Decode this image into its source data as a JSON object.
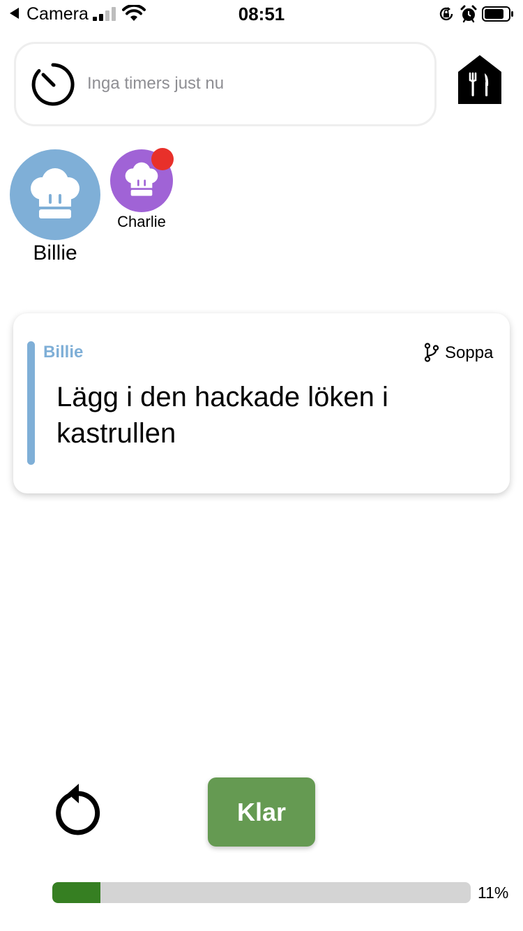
{
  "status_bar": {
    "back_app": "Camera",
    "time": "08:51",
    "icons": [
      "back-arrow-icon",
      "signal-icon",
      "wifi-icon",
      "orientation-lock-icon",
      "alarm-icon",
      "battery-icon"
    ]
  },
  "timer": {
    "text": "Inga timers just nu",
    "icon": "timer-icon"
  },
  "kitchen": {
    "icon": "kitchen-house-icon"
  },
  "cooks": [
    {
      "name": "Billie",
      "color": "#7fafd7",
      "icon": "chef-hat-icon",
      "active": true
    },
    {
      "name": "Charlie",
      "color": "#a063d6",
      "icon": "chef-hat-icon",
      "notification_badge": true,
      "badge_color": "#e8302a"
    }
  ],
  "step": {
    "person": "Billie",
    "recipe": "Soppa",
    "recipe_icon": "branch-icon",
    "instruction": "Lägg i den hackade löken i kastrullen"
  },
  "controls": {
    "undo_icon": "undo-icon",
    "done_label": "Klar",
    "done_color": "#659a52"
  },
  "progress": {
    "fraction": 0.11,
    "label": "11%",
    "fill_color": "#367f22"
  }
}
